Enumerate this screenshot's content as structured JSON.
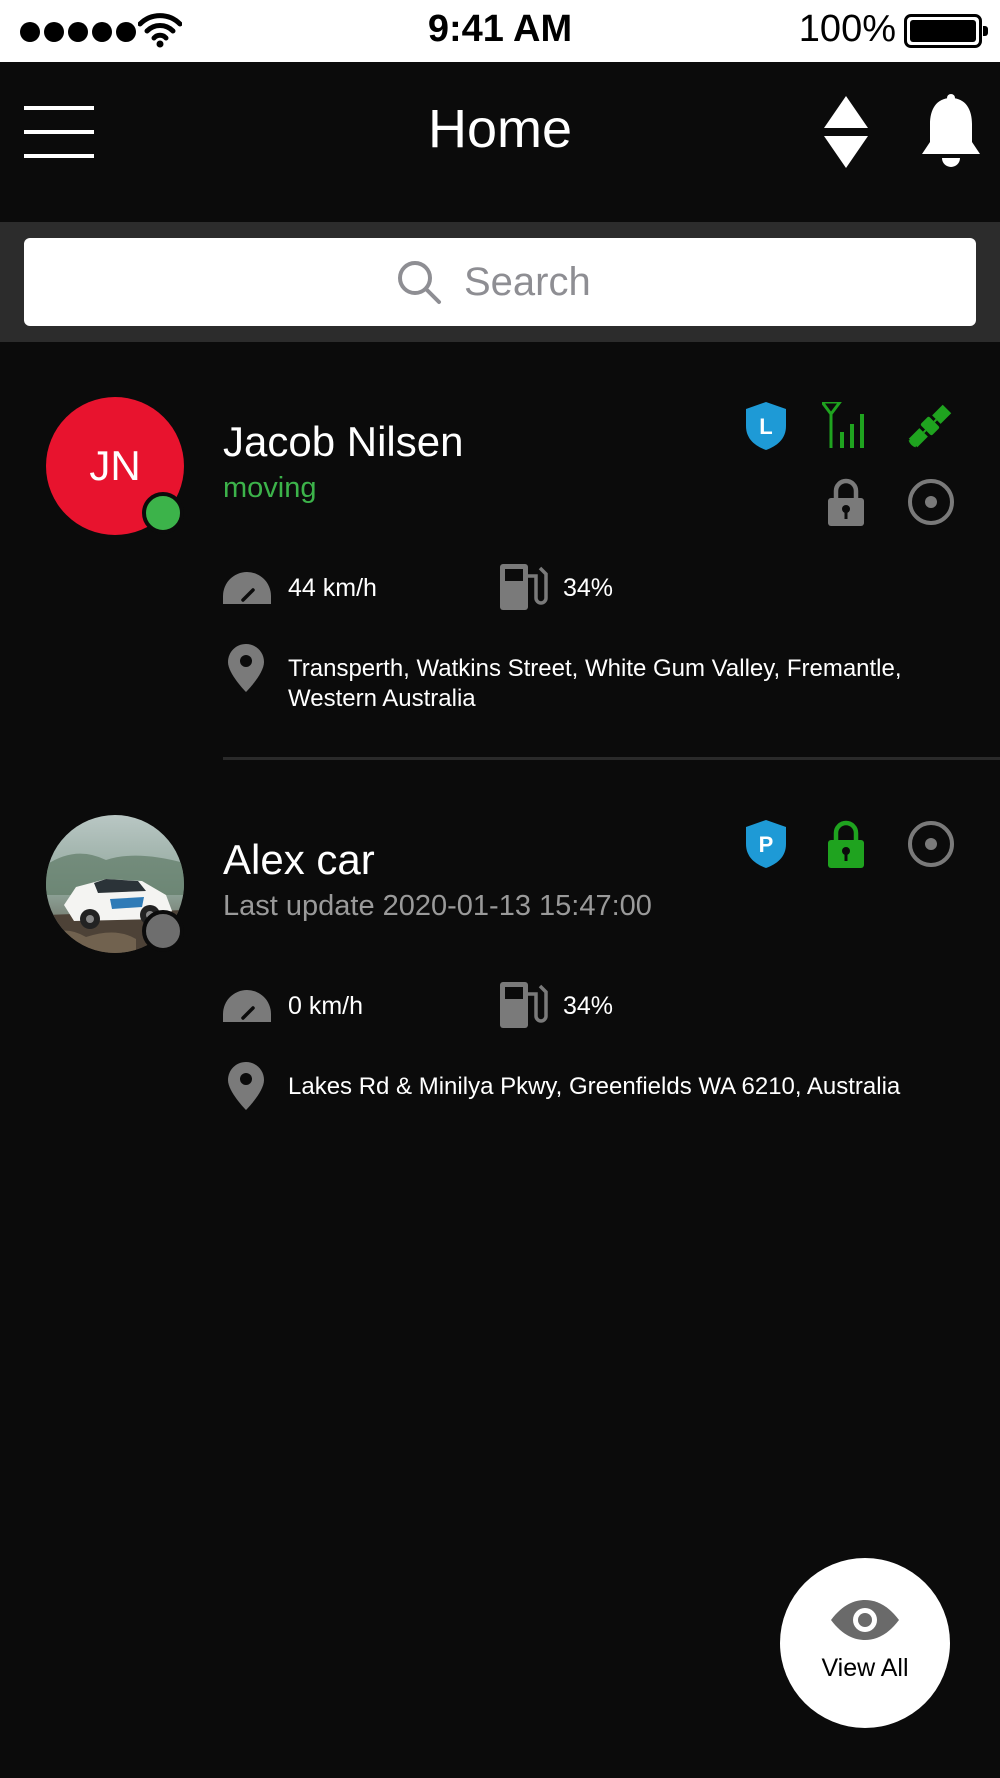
{
  "status_bar": {
    "time": "9:41 AM",
    "battery": "100%"
  },
  "header": {
    "title": "Home"
  },
  "search": {
    "placeholder": "Search"
  },
  "vehicles": [
    {
      "initials": "JN",
      "name": "Jacob Nilsen",
      "status": "moving",
      "status_color": "#3cb34a",
      "online_dot_color": "#3cb34a",
      "badge_letter": "L",
      "speed": "44 km/h",
      "fuel": "34%",
      "address": "Transperth, Watkins Street, White Gum Valley, Fremantle, Western Australia",
      "lock_color": "#7a7a7a"
    },
    {
      "name": "Alex car",
      "status": "Last update 2020-01-13 15:47:00",
      "status_color": "#9a9a9a",
      "online_dot_color": "#6e6e6e",
      "badge_letter": "P",
      "speed": "0 km/h",
      "fuel": "34%",
      "address": "Lakes Rd & Minilya Pkwy, Greenfields WA 6210, Australia",
      "lock_color": "#1fa31f"
    }
  ],
  "view_all": {
    "label": "View All"
  },
  "colors": {
    "background": "#0b0b0b",
    "accent_blue": "#1e9ad6",
    "signal_green": "#1fa31f",
    "avatar_red": "#e8132e"
  }
}
